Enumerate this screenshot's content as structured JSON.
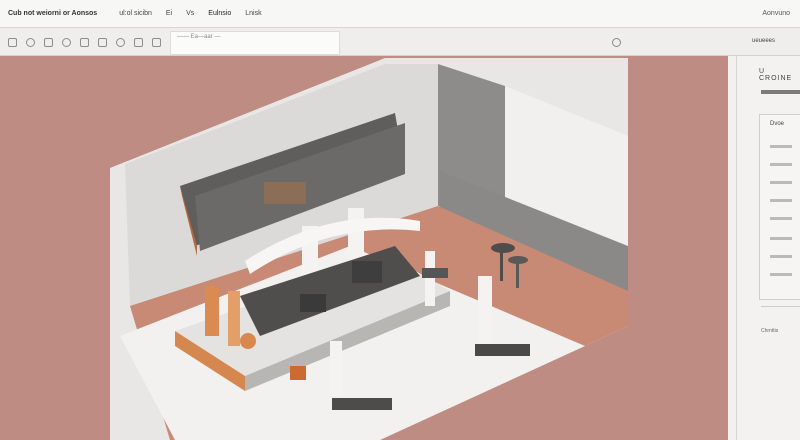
{
  "menubar": {
    "app_title": "Cub not weiorni or Aonsos",
    "items": [
      "ul:ol sicibn",
      "Ei",
      "Vs",
      "Eulnsio",
      "Lnisk"
    ],
    "window_info": "Aonvuno"
  },
  "toolbar": {
    "path_field": "—— Ea—aar —",
    "panel_tab": "ueueees"
  },
  "panel": {
    "header": "U CROINE",
    "group_title": "Dvoe",
    "footer": "Chrnttis"
  },
  "viewport": {
    "background": "#bf8c83"
  }
}
